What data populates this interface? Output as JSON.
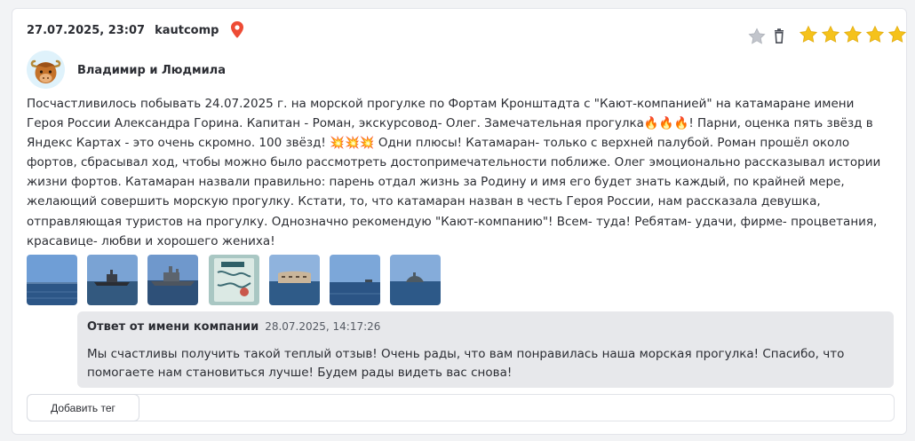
{
  "review": {
    "datetime": "27.07.2025, 23:07",
    "source": "kautcomp",
    "author_name": "Владимир и Людмила",
    "rating": 5,
    "text": "Посчастливилось побывать 24.07.2025 г. на морской прогулке по Фортам Кронштадта с \"Кают-компанией\" на катамаране имени Героя России Александра Горина. Капитан - Роман, экскурсовод- Олег. Замечательная прогулка🔥🔥🔥! Парни, оценка пять звёзд в Яндекс Картах - это очень скромно. 100 звёзд! 💥💥💥 Одни плюсы! Катамаран- только с верхней палубой. Роман прошёл около фортов, сбрасывал ход, чтобы можно было рассмотреть достопримечательности поближе. Олег эмоционально рассказывал истории жизни фортов. Катамаран назвали правильно: парень отдал жизнь за Родину и имя его будет знать каждый, по крайней мере, желающий совершить морскую прогулку. Кстати, то, что катамаран назван в честь Героя России, нам рассказала девушка, отправляющая туристов на прогулку. Однозначно рекомендую \"Кают-компанию\"! Всем- туда! Ребятам- удачи, фирме- процветания, красавице- любви и хорошего жениха!",
    "photos": [
      {
        "icon": "sea-photo-icon"
      },
      {
        "icon": "ship-photo-icon"
      },
      {
        "icon": "warship-photo-icon"
      },
      {
        "icon": "map-photo-icon"
      },
      {
        "icon": "fort-photo-icon"
      },
      {
        "icon": "sea-horizon-photo-icon"
      },
      {
        "icon": "island-photo-icon"
      }
    ]
  },
  "reply": {
    "title": "Ответ от имени компании",
    "datetime": "28.07.2025, 14:17:26",
    "text": "Мы счастливы получить такой теплый отзыв! Очень рады, что вам понравилась наша морская прогулка! Спасибо, что помогаете нам становиться лучше! Будем рады видеть вас снова!"
  },
  "tags": {
    "add_button_label": "Добавить тег"
  },
  "colors": {
    "star": "#f5c21b",
    "pin": "#ee4b35",
    "reply_bg": "#e7e8eb"
  }
}
